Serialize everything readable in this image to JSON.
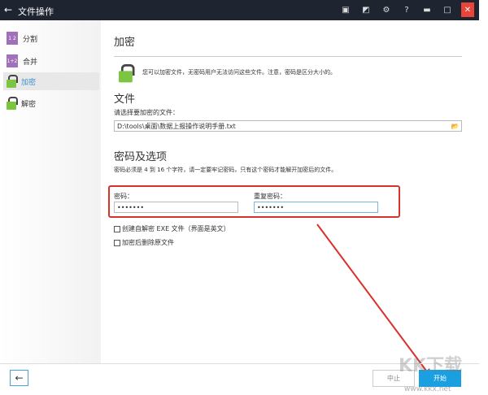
{
  "window": {
    "title": "文件操作"
  },
  "sidebar": {
    "items": [
      {
        "label": "分割",
        "icon": "split-icon",
        "badge": "1 2"
      },
      {
        "label": "合并",
        "icon": "merge-icon",
        "badge": "1+2"
      },
      {
        "label": "加密",
        "icon": "lock-icon"
      },
      {
        "label": "解密",
        "icon": "unlock-icon"
      }
    ]
  },
  "main": {
    "title": "加密",
    "description": "您可以加密文件，无密码用户无法访问这些文件。注意，密码是区分大小的。",
    "file_section": "文件",
    "file_label": "请选择要加密的文件：",
    "file_path": "D:\\tools\\桌面\\数据上报操作说明手册.txt",
    "options_section": "密码及选项",
    "password_hint": "密码必须是 4 到 16 个字符，请一定要牢记密码，只有这个密码才能解开加密后的文件。",
    "password_label": "密码：",
    "password_value": "•••••••",
    "repeat_label": "重复密码：",
    "repeat_value": "•••••••",
    "checkbox_exe": "创建自解密 EXE 文件（界面是英文）",
    "checkbox_delete": "加密后删除原文件"
  },
  "footer": {
    "stop": "中止",
    "start": "开始"
  },
  "watermark": {
    "logo": "KK下载",
    "url": "www.kkx.net"
  },
  "colors": {
    "accent": "#1aa0e0",
    "highlight": "#d9312b"
  }
}
